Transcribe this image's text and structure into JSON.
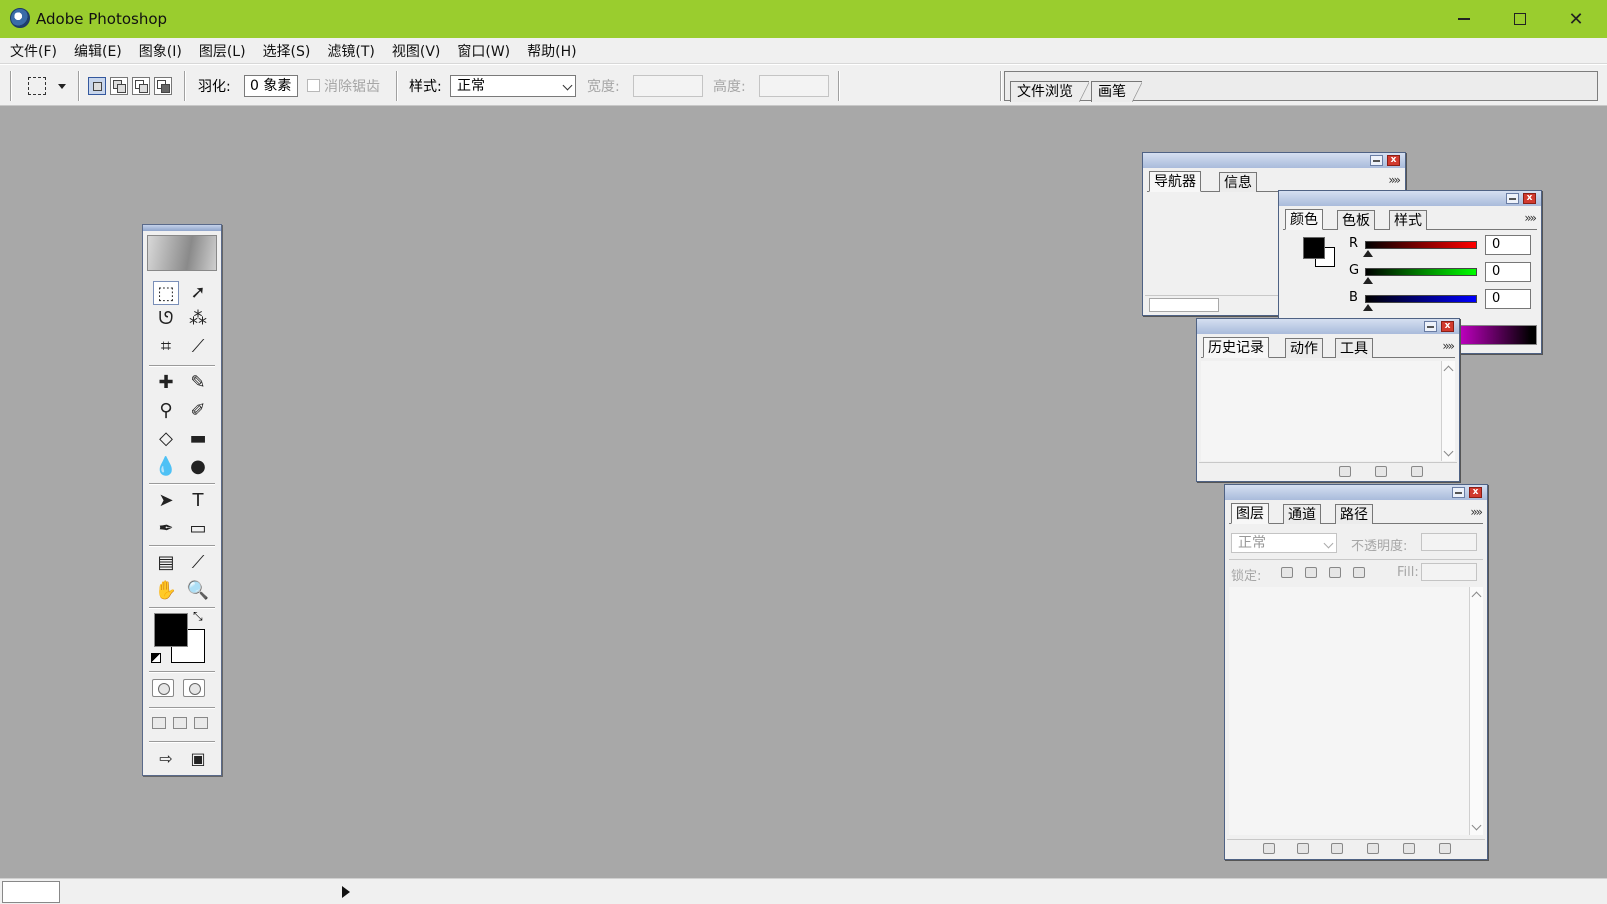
{
  "window": {
    "title": "Adobe Photoshop",
    "accent": "#9acd2e"
  },
  "menu": [
    "文件(F)",
    "编辑(E)",
    "图象(I)",
    "图层(L)",
    "选择(S)",
    "滤镜(T)",
    "视图(V)",
    "窗口(W)",
    "帮助(H)"
  ],
  "options": {
    "feather_label": "羽化:",
    "feather_value": "0 象素",
    "antialias_label": "消除锯齿",
    "style_label": "样式:",
    "style_value": "正常",
    "width_label": "宽度:",
    "height_label": "高度:"
  },
  "palette_well": {
    "tabs": [
      "文件浏览",
      "画笔"
    ]
  },
  "navigator": {
    "tabs": [
      "导航器",
      "信息"
    ]
  },
  "color": {
    "tabs": [
      "颜色",
      "色板",
      "样式"
    ],
    "channels": [
      {
        "label": "R",
        "value": "0",
        "color": "#d01010"
      },
      {
        "label": "G",
        "value": "0",
        "color": "#10b010"
      },
      {
        "label": "B",
        "value": "0",
        "color": "#1010d0"
      }
    ]
  },
  "history": {
    "tabs": [
      "历史记录",
      "动作",
      "工具"
    ]
  },
  "layers": {
    "tabs": [
      "图层",
      "通道",
      "路径"
    ],
    "blend_mode": "正常",
    "opacity_label": "不透明度:",
    "lock_label": "锁定:",
    "fill_label": "Fill:"
  },
  "toolbox": {
    "tools": [
      "rectangular-marquee-icon",
      "move-icon",
      "lasso-icon",
      "magic-wand-icon",
      "crop-icon",
      "slice-icon",
      "healing-brush-icon",
      "brush-icon",
      "clone-stamp-icon",
      "history-brush-icon",
      "eraser-icon",
      "gradient-icon",
      "blur-icon",
      "dodge-icon",
      "path-selection-icon",
      "type-icon",
      "pen-icon",
      "rectangle-icon",
      "notes-icon",
      "eyedropper-icon",
      "hand-icon",
      "zoom-icon"
    ],
    "foreground": "#000000",
    "background": "#ffffff"
  }
}
